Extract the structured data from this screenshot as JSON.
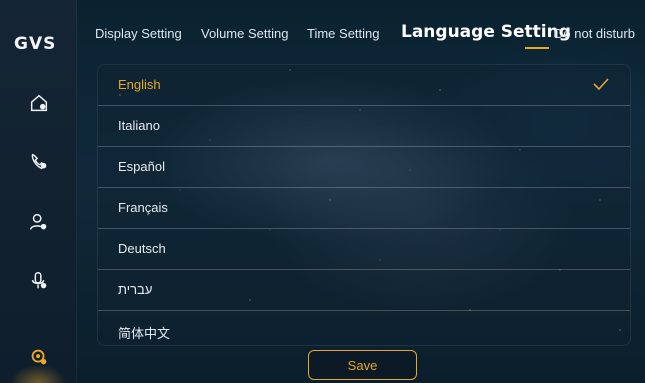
{
  "app": {
    "logo": "GVS"
  },
  "sidebar": {
    "items": [
      {
        "icon": "home-icon"
      },
      {
        "icon": "phone-icon"
      },
      {
        "icon": "user-settings-icon"
      },
      {
        "icon": "mic-icon"
      },
      {
        "icon": "settings-icon",
        "active": true
      }
    ],
    "accent_color": "#e8a72a"
  },
  "tabs": [
    {
      "label": "Display Setting"
    },
    {
      "label": "Volume Setting"
    },
    {
      "label": "Time Setting"
    },
    {
      "label": "Language Setting",
      "active": true
    },
    {
      "label": "Do not disturb"
    }
  ],
  "languages": [
    {
      "label": "English",
      "selected": true
    },
    {
      "label": "Italiano"
    },
    {
      "label": "Español"
    },
    {
      "label": "Français"
    },
    {
      "label": "Deutsch"
    },
    {
      "label": "עברית"
    },
    {
      "label": "简体中文"
    }
  ],
  "save_label": "Save",
  "colors": {
    "accent": "#e8a72a",
    "text": "#e6ebf2"
  }
}
